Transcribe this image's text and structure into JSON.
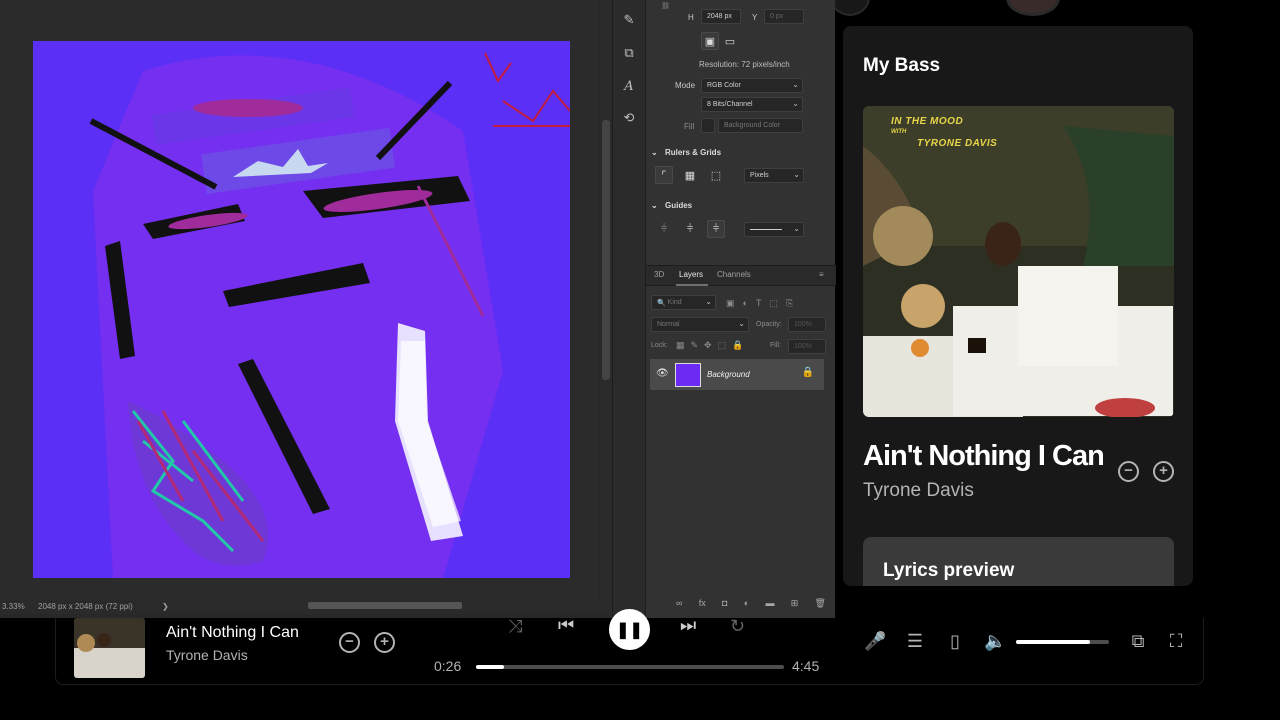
{
  "photoshop": {
    "status_zoom": "3.33%",
    "status_doc": "2048 px x 2048 px (72 ppi)",
    "status_arrow": "❯",
    "image_size": {
      "h_label": "H",
      "h_value": "2048 px",
      "y_label": "Y",
      "y_value": "0 px",
      "resolution": "Resolution: 72 pixels/inch",
      "mode_label": "Mode",
      "mode_value": "RGB Color",
      "bits_value": "8 Bits/Channel",
      "fill_label": "Fill",
      "fill_value": "Background Color"
    },
    "rulers_grids": {
      "header": "Rulers & Grids",
      "units": "Pixels"
    },
    "guides": {
      "header": "Guides"
    },
    "tabs": [
      "3D",
      "Layers",
      "Channels"
    ],
    "layers": {
      "kind_placeholder": "Kind",
      "blend_mode": "Normal",
      "opacity_label": "Opacity:",
      "opacity_value": "100%",
      "lock_label": "Lock:",
      "fill_label": "Fill:",
      "fill_value": "100%",
      "items": [
        {
          "name": "Background"
        }
      ]
    }
  },
  "now_playing": {
    "playlist_title": "My Bass",
    "cover_text_line1": "IN THE MOOD",
    "cover_text_line2": "WITH",
    "cover_text_line3": "TYRONE DAVIS",
    "song": "Ain't Nothing I Can",
    "artist": "Tyrone Davis",
    "lyrics_header": "Lyrics preview"
  },
  "player": {
    "title": "Ain't Nothing I Can",
    "artist": "Tyrone Davis",
    "elapsed": "0:26",
    "duration": "4:45",
    "progress_fraction": 0.09,
    "volume_fraction": 0.8
  },
  "icons": {
    "minus": "−",
    "plus": "+",
    "shuffle": "⤨",
    "prev": "⏮",
    "pause": "❚❚",
    "next": "⏭",
    "repeat": "↻",
    "eye": "👁",
    "lock": "🔒"
  }
}
